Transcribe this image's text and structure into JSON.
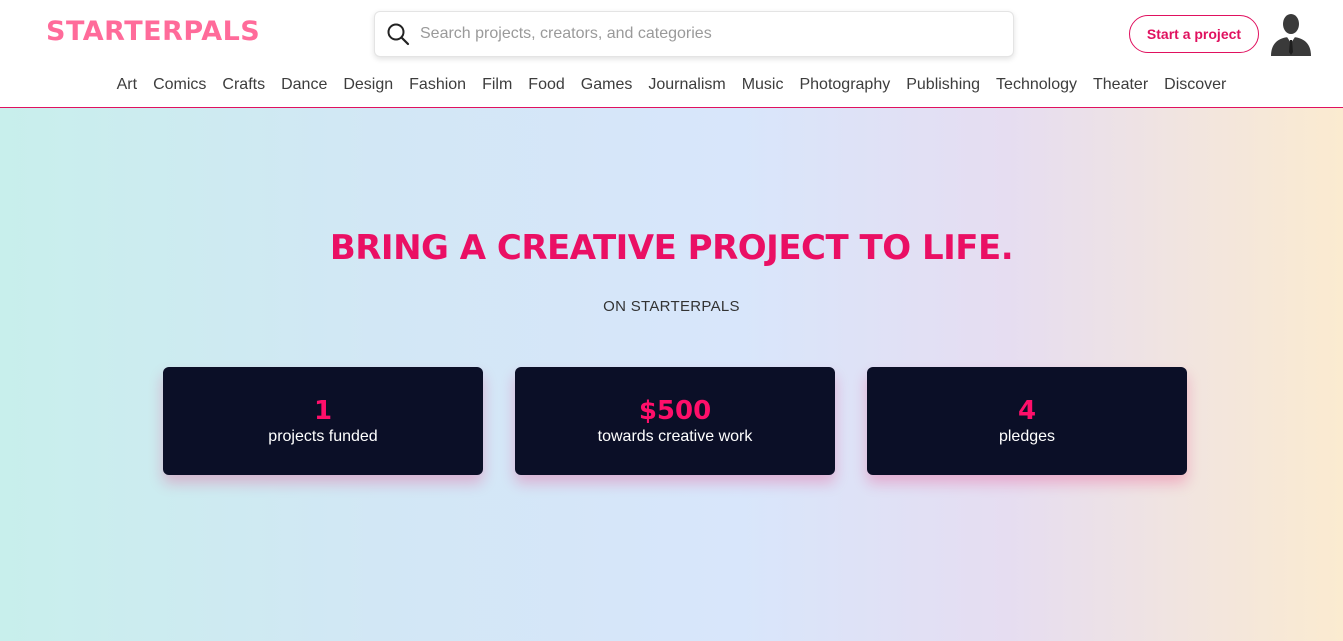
{
  "header": {
    "logo": "STARTERPALS",
    "search_placeholder": "Search projects, creators, and categories",
    "start_button": "Start a project"
  },
  "nav": {
    "items": [
      "Art",
      "Comics",
      "Crafts",
      "Dance",
      "Design",
      "Fashion",
      "Film",
      "Food",
      "Games",
      "Journalism",
      "Music",
      "Photography",
      "Publishing",
      "Technology",
      "Theater",
      "Discover"
    ]
  },
  "hero": {
    "title": "BRING A CREATIVE PROJECT TO LIFE.",
    "subtitle": "ON STARTERPALS",
    "stats": [
      {
        "value": "1",
        "label": "projects funded"
      },
      {
        "value": "$500",
        "label": "towards creative work"
      },
      {
        "value": "4",
        "label": "pledges"
      }
    ]
  },
  "colors": {
    "brand": "#ea0f64",
    "logo": "#ff6b9a",
    "card_bg": "#0b0f27"
  }
}
